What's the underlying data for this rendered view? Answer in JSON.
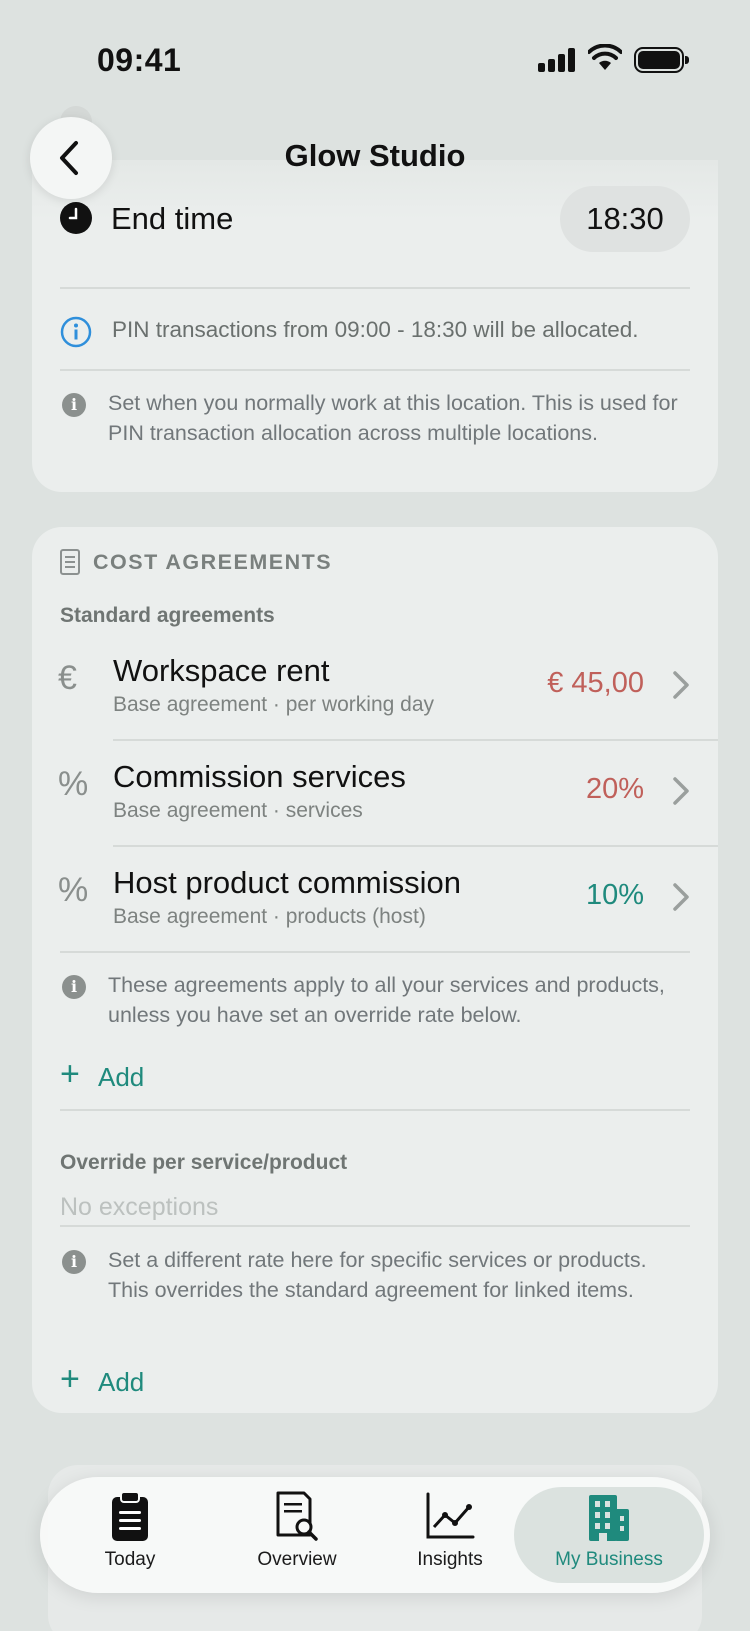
{
  "status_bar": {
    "time": "09:41"
  },
  "header": {
    "title": "Glow Studio"
  },
  "work_hours": {
    "end_label": "End time",
    "end_value": "18:30",
    "allocation_info": "PIN transactions from 09:00 - 18:30 will be allocated.",
    "note": "Set when you normally work at this location. This is used for PIN transaction allocation across multiple locations."
  },
  "cost_agreements": {
    "section_title": "COST AGREEMENTS",
    "standard_title": "Standard agreements",
    "items": [
      {
        "symbol": "€",
        "title": "Workspace rent",
        "subtitle": "Base agreement · per working day",
        "amount": "€ 45,00",
        "amount_color": "#c0605a"
      },
      {
        "symbol": "%",
        "title": "Commission services",
        "subtitle": "Base agreement · services",
        "amount": "20%",
        "amount_color": "#c0605a"
      },
      {
        "symbol": "%",
        "title": "Host product commission",
        "subtitle": "Base agreement · products (host)",
        "amount": "10%",
        "amount_color": "#1f8a7d"
      }
    ],
    "standard_note": "These agreements apply to all your services and products, unless you have set an override rate below.",
    "add_label": "Add",
    "override_title": "Override per service/product",
    "override_empty": "No exceptions",
    "override_note": "Set a different rate here for specific services or products. This overrides the standard agreement for linked items.",
    "override_add_label": "Add"
  },
  "tabbar": {
    "tabs": [
      {
        "label": "Today",
        "icon": "clipboard-icon"
      },
      {
        "label": "Overview",
        "icon": "document-search-icon"
      },
      {
        "label": "Insights",
        "icon": "line-chart-icon"
      },
      {
        "label": "My Business",
        "icon": "building-icon",
        "active": true
      }
    ]
  },
  "colors": {
    "accent": "#1f8a7d",
    "negative": "#c0605a",
    "info_blue": "#2f8fdb"
  }
}
